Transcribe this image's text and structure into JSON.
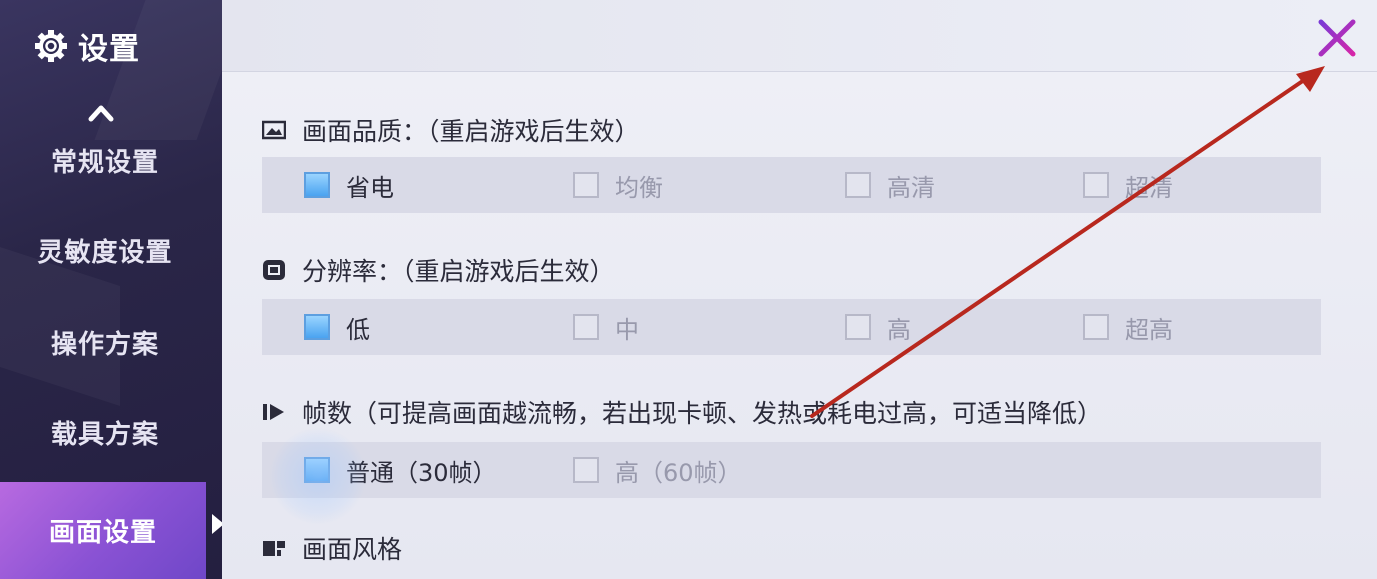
{
  "sidebar": {
    "title": "设置",
    "items": [
      {
        "label": "常规设置"
      },
      {
        "label": "灵敏度设置"
      },
      {
        "label": "操作方案"
      },
      {
        "label": "载具方案"
      },
      {
        "label": "画面设置"
      }
    ],
    "active_index": 4
  },
  "sections": [
    {
      "title": "画面品质：（重启游戏后生效）",
      "options": [
        {
          "label": "省电",
          "selected": true
        },
        {
          "label": "均衡",
          "selected": false
        },
        {
          "label": "高清",
          "selected": false
        },
        {
          "label": "超清",
          "selected": false
        }
      ]
    },
    {
      "title": "分辨率：（重启游戏后生效）",
      "options": [
        {
          "label": "低",
          "selected": true
        },
        {
          "label": "中",
          "selected": false
        },
        {
          "label": "高",
          "selected": false
        },
        {
          "label": "超高",
          "selected": false
        }
      ]
    },
    {
      "title": "帧数（可提高画面越流畅，若出现卡顿、发热或耗电过高，可适当降低）",
      "options": [
        {
          "label": "普通（30帧）",
          "selected": true
        },
        {
          "label": "高（60帧）",
          "selected": false
        }
      ]
    },
    {
      "title": "画面风格"
    }
  ],
  "colors": {
    "accent_purple": "#8a52d4",
    "close_icon": "#c02ab0",
    "annotation_arrow": "#b8281e",
    "checkbox_on": "#4aa3f0"
  }
}
